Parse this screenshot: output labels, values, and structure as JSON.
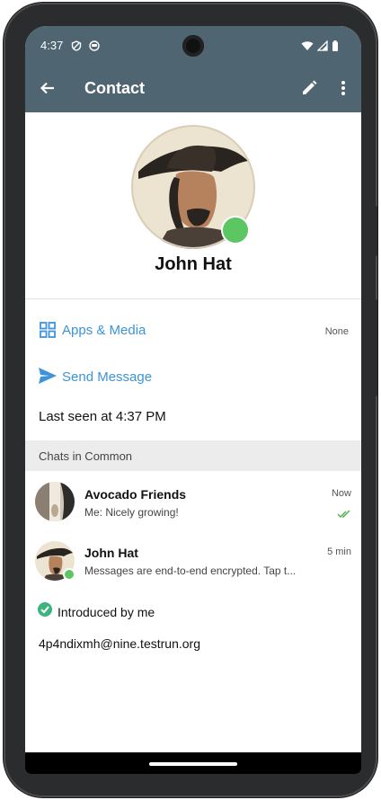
{
  "status_bar": {
    "time": "4:37"
  },
  "app_bar": {
    "title": "Contact"
  },
  "profile": {
    "name": "John Hat"
  },
  "actions": {
    "apps_media_label": "Apps & Media",
    "apps_media_count": "None",
    "send_message_label": "Send Message"
  },
  "last_seen": "Last seen at 4:37 PM",
  "chats_section": {
    "header": "Chats in Common",
    "items": [
      {
        "title": "Avocado Friends",
        "subtitle": "Me: Nicely growing!",
        "time": "Now",
        "read": true
      },
      {
        "title": "John Hat",
        "subtitle": "Messages are end-to-end encrypted. Tap t...",
        "time": "5 min",
        "online": true
      }
    ]
  },
  "introduced_by": "Introduced by me",
  "email": "4p4ndixmh@nine.testrun.org",
  "colors": {
    "app_bar": "#4f6672",
    "link": "#3e93d9",
    "online": "#5cc663",
    "verified": "#3fb37f",
    "read_check": "#4caf50"
  }
}
